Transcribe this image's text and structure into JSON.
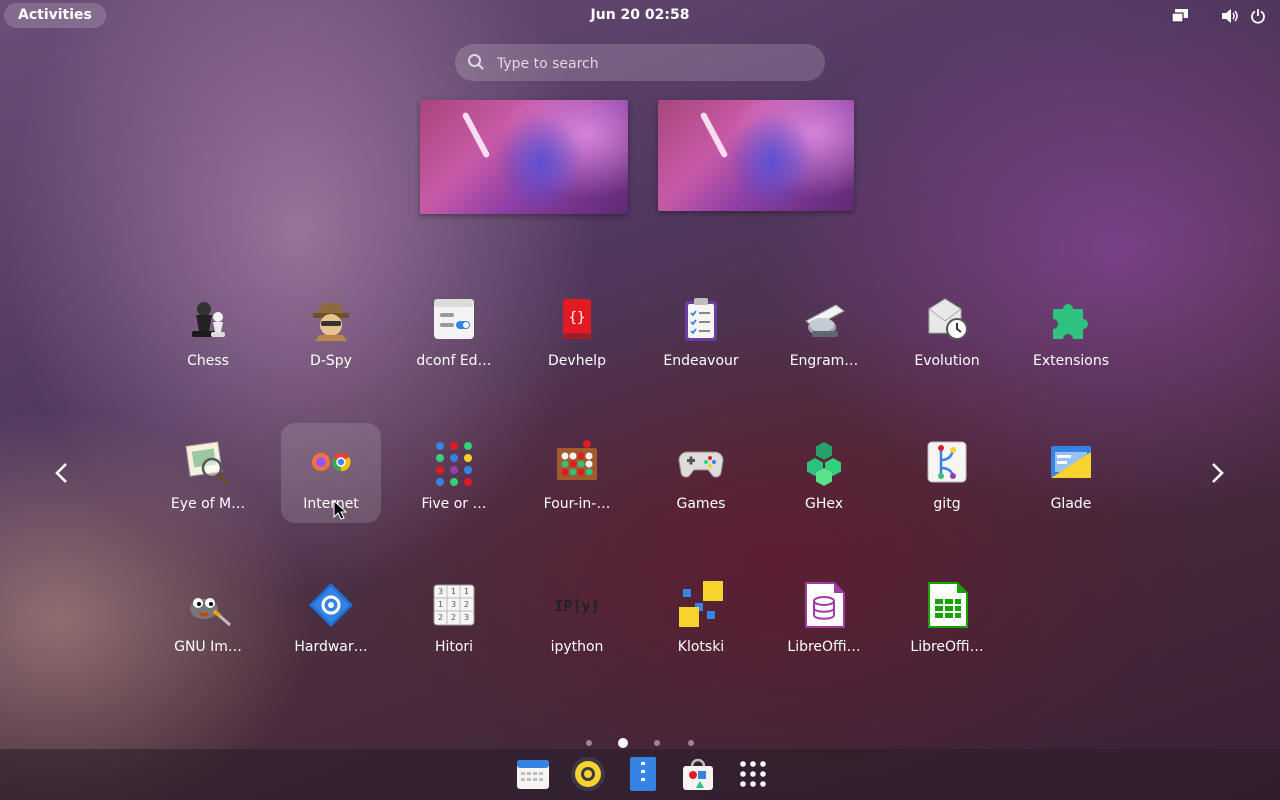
{
  "topbar": {
    "activities_label": "Activities",
    "clock": "Jun 20  02:58",
    "tray_icons": [
      "display-icon",
      "volume-icon",
      "power-icon"
    ]
  },
  "search": {
    "placeholder": "Type to search",
    "value": ""
  },
  "apps": [
    {
      "label": "Chess",
      "icon": "chess-icon"
    },
    {
      "label": "D-Spy",
      "icon": "d-spy-icon"
    },
    {
      "label": "dconf Ed…",
      "icon": "dconf-editor-icon"
    },
    {
      "label": "Devhelp",
      "icon": "devhelp-icon"
    },
    {
      "label": "Endeavour",
      "icon": "endeavour-icon"
    },
    {
      "label": "Engram…",
      "icon": "engrampa-icon"
    },
    {
      "label": "Evolution",
      "icon": "evolution-icon"
    },
    {
      "label": "Extensions",
      "icon": "extensions-icon"
    },
    {
      "label": "Eye of M…",
      "icon": "eye-of-mate-icon"
    },
    {
      "label": "Internet",
      "icon": "internet-folder-icon"
    },
    {
      "label": "Five or …",
      "icon": "five-or-more-icon"
    },
    {
      "label": "Four-in-…",
      "icon": "four-in-a-row-icon"
    },
    {
      "label": "Games",
      "icon": "games-icon"
    },
    {
      "label": "GHex",
      "icon": "ghex-icon"
    },
    {
      "label": "gitg",
      "icon": "gitg-icon"
    },
    {
      "label": "Glade",
      "icon": "glade-icon"
    },
    {
      "label": "GNU Im…",
      "icon": "gimp-icon"
    },
    {
      "label": "Hardwar…",
      "icon": "hardware-icon"
    },
    {
      "label": "Hitori",
      "icon": "hitori-icon"
    },
    {
      "label": "ipython",
      "icon": "ipython-icon"
    },
    {
      "label": "Klotski",
      "icon": "klotski-icon"
    },
    {
      "label": "LibreOffi…",
      "icon": "libreoffice-base-icon"
    },
    {
      "label": "LibreOffi…",
      "icon": "libreoffice-calc-icon"
    }
  ],
  "selected_app": "Internet",
  "pages": {
    "count": 4,
    "current": 2
  },
  "dock": [
    "calendar-icon",
    "rhythmbox-icon",
    "files-icon",
    "software-icon",
    "show-apps-icon"
  ],
  "colors": {
    "accent": "#ffffff",
    "panel": "#000000"
  }
}
